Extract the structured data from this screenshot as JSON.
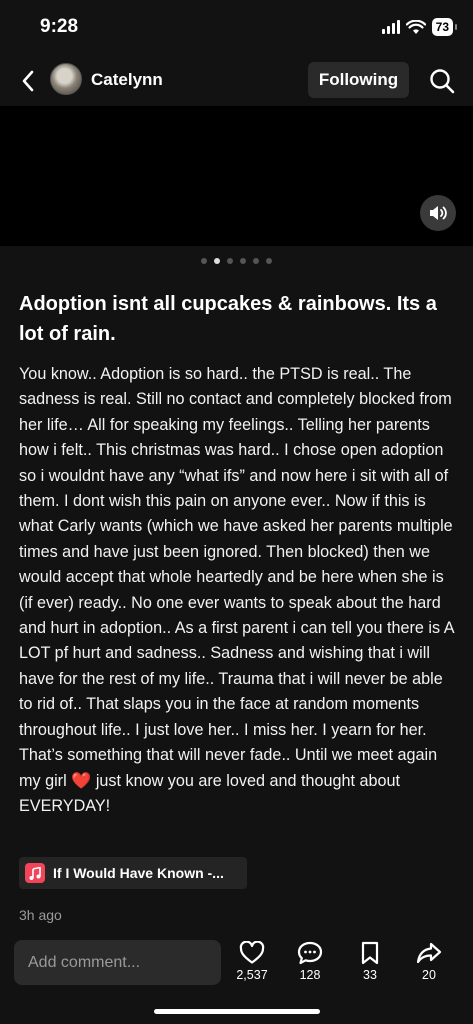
{
  "status_bar": {
    "time": "9:28",
    "battery": "73"
  },
  "nav": {
    "username": "Catelynn",
    "following_label": "Following"
  },
  "carousel": {
    "count": 6,
    "active_index": 1
  },
  "post": {
    "title": "Adoption isnt all cupcakes & rainbows. Its a lot of rain.",
    "body_before_emoji": "You know.. Adoption is so hard.. the PTSD is real.. The sadness is real. Still no contact and completely blocked from her life… All for speaking my feelings.. Telling her parents how i felt.. This christmas was hard.. I chose open adoption so i wouldnt have any “what ifs” and now here i sit with all of them. I dont wish this pain on anyone ever.. Now if this is what Carly wants (which we have asked her parents multiple times and have just been ignored. Then blocked) then we would accept that whole heartedly and be here when she is (if ever) ready.. No one ever wants to speak about the hard and hurt in adoption.. As a first parent i can tell you there is A LOT pf hurt and sadness.. Sadness and wishing that i will have for the rest of my life.. Trauma that i will never be able to rid of.. That slaps you in the face at random moments throughout life.. I just love her.. I miss her. I yearn for her. That’s something that will never fade.. Until we meet again my girl",
    "emoji": "❤️",
    "body_after_emoji": " just know you are loved and thought about EVERYDAY!",
    "music_title": "If I Would Have Known -...",
    "time_ago": "3h ago"
  },
  "bottom_bar": {
    "comment_placeholder": "Add comment...",
    "likes": "2,537",
    "comments": "128",
    "saves": "33",
    "shares": "20"
  },
  "colors": {
    "background": "#121212",
    "chip": "#2a2a2a",
    "music_accent": "#f2455a",
    "heart": "#e53b3b"
  }
}
